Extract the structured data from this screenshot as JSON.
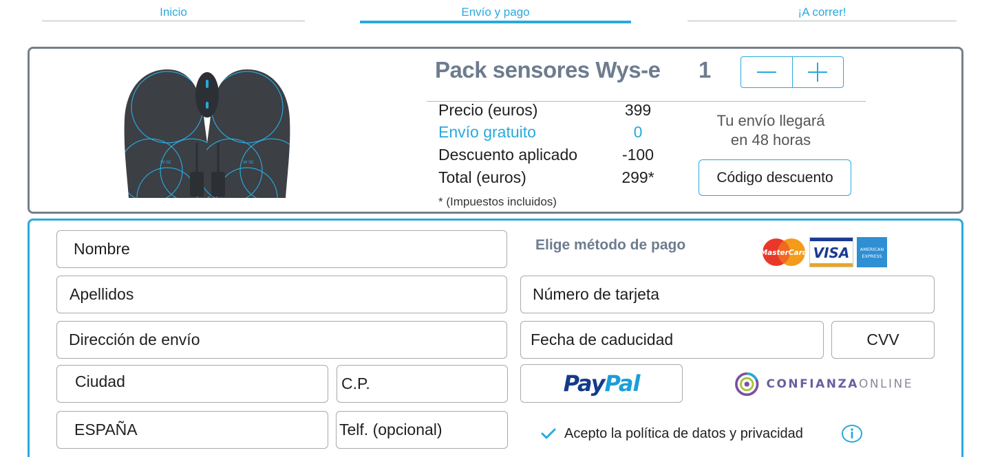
{
  "steps": [
    {
      "label": "Inicio",
      "active": false
    },
    {
      "label": "Envío y pago",
      "active": true
    },
    {
      "label": "¡A correr!",
      "active": false
    }
  ],
  "product": {
    "title": "Pack sensores Wys-e",
    "quantity": "1",
    "brand_mark": "W·SE"
  },
  "pricing": [
    {
      "label": "Precio (euros)",
      "value": "399"
    },
    {
      "label": "Envío gratuito",
      "value": "0"
    },
    {
      "label": "Descuento aplicado",
      "value": "-100"
    },
    {
      "label": "Total (euros)",
      "value": "299*"
    }
  ],
  "taxes_note": "* (Impuestos incluidos)",
  "delivery": {
    "line1": "Tu envío llegará",
    "line2": "en 48 horas"
  },
  "discount_button": "Código descuento",
  "form": {
    "name": "Nombre",
    "surname": "Apellidos",
    "address": "Dirección de envío",
    "city": "Ciudad",
    "postal_code": "C.P.",
    "country": "ESPAÑA",
    "phone": "Telf. (opcional)"
  },
  "payment": {
    "title": "Elige método de pago",
    "cards": [
      {
        "name": "mastercard",
        "text": "MasterCard"
      },
      {
        "name": "visa",
        "text": "VISA"
      },
      {
        "name": "amex",
        "text1": "AMERICAN",
        "text2": "EXPRESS"
      }
    ],
    "card_number": "Número de tarjeta",
    "expiry": "Fecha de caducidad",
    "cvv": "CVV",
    "paypal": {
      "part1": "Pay",
      "part2": "Pal"
    },
    "trust": {
      "part1": "CONFIANZA",
      "part2": "ONLINE"
    }
  },
  "consent": {
    "text": "Acepto la política de datos y privacidad",
    "checked": true
  },
  "colors": {
    "accent": "#29a9dc",
    "title_gray": "#6d7c8f",
    "card_border": "#757f89",
    "paypal_dark": "#143b8a",
    "paypal_light": "#1b9ed8",
    "mastercard_red": "#e8382a",
    "mastercard_orange": "#f39b1b",
    "visa_blue": "#1a3a94",
    "visa_gold": "#e9a623",
    "amex_blue": "#2f8fd3"
  },
  "icons": [
    "minus-icon",
    "plus-icon",
    "check-icon",
    "info-icon"
  ]
}
